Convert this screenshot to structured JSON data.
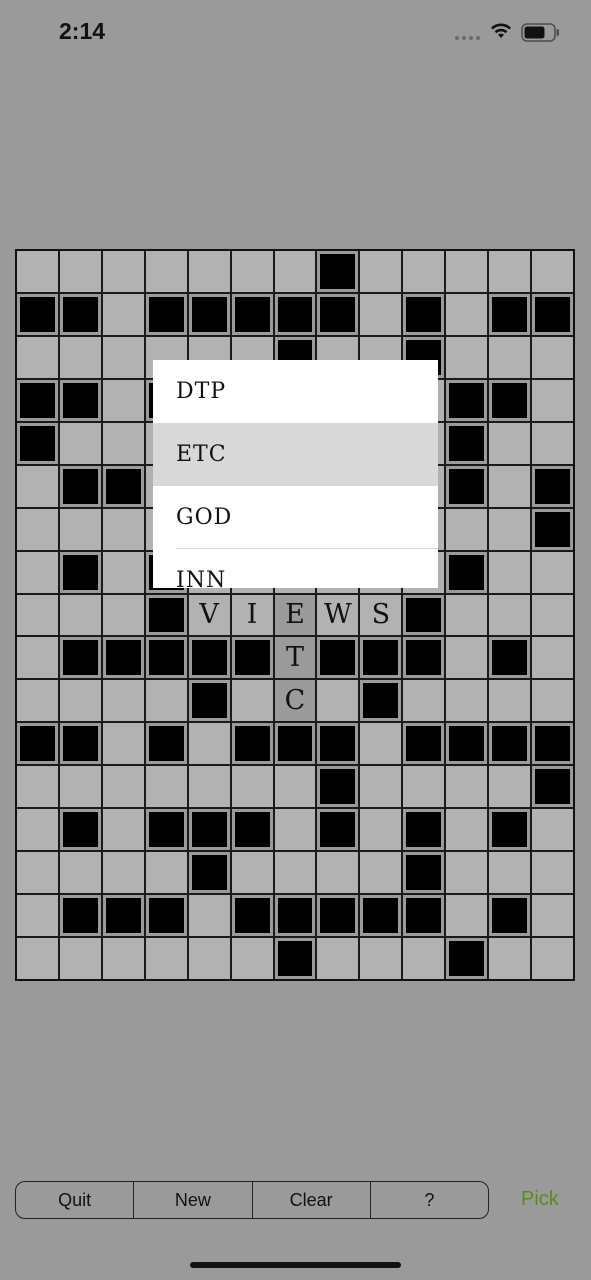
{
  "status_bar": {
    "time": "2:14",
    "icons": [
      "signal-dots-icon",
      "wifi-icon",
      "battery-icon"
    ]
  },
  "colors": {
    "background": "#9a9a9a",
    "cell": "#b2b2b2",
    "block": "#000000",
    "highlight": "#9b9b9b",
    "pick": "#5d8a1e"
  },
  "board": {
    "rows": [
      "_______#_____",
      "##_#####_#_##",
      "______#__#___",
      "##_#______##_",
      "#_________#__",
      "_##_______#_#",
      "____________#",
      "_#_#______#__",
      "___#VIEWS#___",
      "_#####T###_#_",
      "____#_C_#____",
      "##_#_###_####",
      "_______#____#",
      "_#_###_#_#_#_",
      "____#____#___",
      "_###_#####_#_",
      "______#___#__"
    ],
    "highlight": [
      [
        8,
        6
      ],
      [
        9,
        6
      ],
      [
        10,
        6
      ]
    ]
  },
  "word_picker": {
    "items": [
      {
        "label": "DTP",
        "selected": false
      },
      {
        "label": "ETC",
        "selected": true
      },
      {
        "label": "GOD",
        "selected": false
      },
      {
        "label": "INN",
        "selected": false
      }
    ]
  },
  "toolbar": {
    "quit_label": "Quit",
    "new_label": "New",
    "clear_label": "Clear",
    "help_label": "?"
  },
  "pick_label": "Pick"
}
